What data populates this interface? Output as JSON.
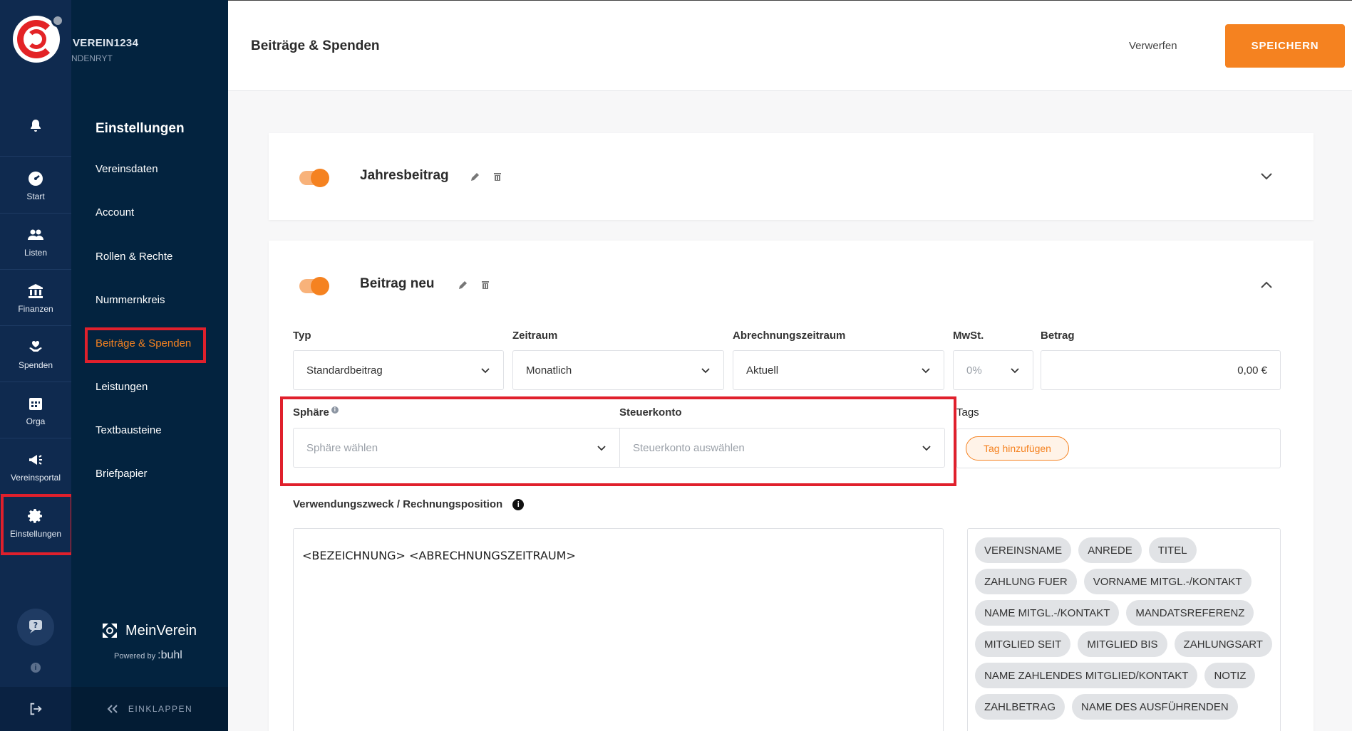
{
  "app": {
    "org_name": "VEREIN1234",
    "org_sub": "NDENRYT"
  },
  "rail": {
    "items": [
      {
        "label": "Start"
      },
      {
        "label": "Listen"
      },
      {
        "label": "Finanzen"
      },
      {
        "label": "Spenden"
      },
      {
        "label": "Orga"
      },
      {
        "label": "Vereinsportal"
      },
      {
        "label": "Einstellungen"
      }
    ],
    "info_glyph": "i"
  },
  "subnav": {
    "title": "Einstellungen",
    "items": [
      {
        "label": "Vereinsdaten"
      },
      {
        "label": "Account"
      },
      {
        "label": "Rollen & Rechte"
      },
      {
        "label": "Nummernkreis"
      },
      {
        "label": "Beiträge & Spenden"
      },
      {
        "label": "Leistungen"
      },
      {
        "label": "Textbausteine"
      },
      {
        "label": "Briefpapier"
      }
    ],
    "brand": "MeinVerein",
    "powered_by": "Powered by",
    "powered_brand": ":buhl",
    "collapse_label": "EINKLAPPEN"
  },
  "header": {
    "title": "Beiträge & Spenden",
    "discard_label": "Verwerfen",
    "save_label": "SPEICHERN"
  },
  "cards": [
    {
      "title": "Jahresbeitrag",
      "enabled": true,
      "expanded": false
    },
    {
      "title": "Beitrag neu",
      "enabled": true,
      "expanded": true
    }
  ],
  "form": {
    "typ": {
      "label": "Typ",
      "value": "Standardbeitrag"
    },
    "zeitraum": {
      "label": "Zeitraum",
      "value": "Monatlich"
    },
    "abrechnung": {
      "label": "Abrechnungszeitraum",
      "value": "Aktuell"
    },
    "mwst": {
      "label": "MwSt.",
      "value": "0%"
    },
    "betrag": {
      "label": "Betrag",
      "value": "0,00 €"
    },
    "sphaere": {
      "label": "Sphäre",
      "placeholder": "Sphäre wählen",
      "info_glyph": "i"
    },
    "steuerkonto": {
      "label": "Steuerkonto",
      "placeholder": "Steuerkonto auswählen"
    },
    "tags": {
      "label": "Tags",
      "add_label": "Tag hinzufügen"
    },
    "verwendungszweck": {
      "label": "Verwendungszweck / Rechnungsposition",
      "info_glyph": "i",
      "value": "<BEZEICHNUNG> <ABRECHNUNGSZEITRAUM>"
    },
    "placeholders": [
      "VEREINSNAME",
      "ANREDE",
      "TITEL",
      "ZAHLUNG FUER",
      "VORNAME MITGL.-/KONTAKT",
      "NAME MITGL.-/KONTAKT",
      "MANDATSREFERENZ",
      "MITGLIED SEIT",
      "MITGLIED BIS",
      "ZAHLUNGSART",
      "NAME ZAHLENDES MITGLIED/KONTAKT",
      "NOTIZ",
      "ZAHLBETRAG",
      "NAME DES AUSFÜHRENDEN"
    ]
  },
  "colors": {
    "accent": "#f58220",
    "rail_bg": "#0f2a4f",
    "subnav_bg": "#03233f",
    "highlight_red": "#e0202c"
  }
}
